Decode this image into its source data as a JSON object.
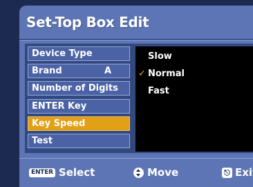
{
  "title": "Set-Top Box Edit",
  "menu": {
    "items": [
      {
        "label": "Device Type",
        "value": ""
      },
      {
        "label": "Brand",
        "value": "A"
      },
      {
        "label": "Number of Digits",
        "value": ""
      },
      {
        "label": "ENTER Key",
        "value": ""
      },
      {
        "label": "Key Speed",
        "value": ""
      },
      {
        "label": "Test",
        "value": ""
      }
    ],
    "selected_index": 4
  },
  "options": {
    "items": [
      "Slow",
      "Normal",
      "Fast"
    ],
    "checked_index": 1,
    "check_mark": "✓"
  },
  "footer": {
    "select_key": "ENTER",
    "select_label": "Select",
    "move_icon": "up-down-icon",
    "move_label": "Move",
    "exit_icon": "exit-icon",
    "exit_label": "Exit"
  },
  "colors": {
    "dialog": "#5d75b5",
    "selected": "#e2a017",
    "check": "#e8a91a"
  }
}
